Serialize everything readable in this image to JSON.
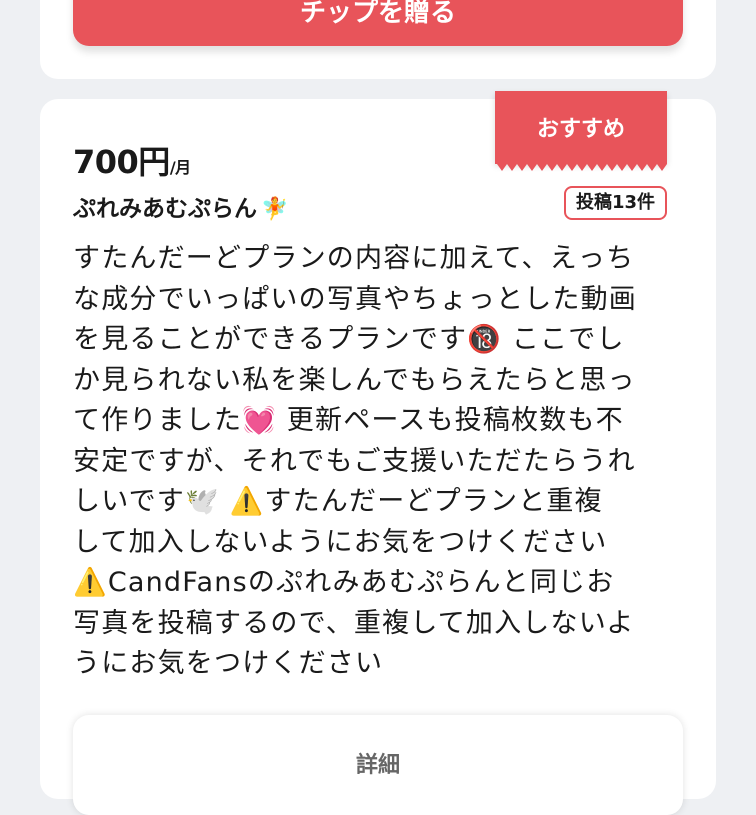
{
  "tip_section": {
    "tip_button_label": "チップを贈る"
  },
  "plan": {
    "recommend_badge": "おすすめ",
    "price_value": "700円",
    "price_unit": "/月",
    "name": "ぷれみあむぷらん",
    "name_icon": "🧚",
    "post_count_label": "投稿13件",
    "description_lines": [
      "すたんだーどプランの内容に加えて、えっち",
      "な成分でいっぱいの写真やちょっとした動画",
      "を見ることができるプランです🔞 ここでし",
      "か見られない私を楽しんでもらえたらと思っ",
      "て作りました💓 更新ペースも投稿枚数も不",
      "安定ですが、それでもご支援いただたらうれ",
      "しいです🕊️ ⚠️すたんだーどプランと重複",
      "して加入しないようにお気をつけください",
      "⚠️CandFansのぷれみあむぷらんと同じお",
      "写真を投稿するので、重複して加入しないよ",
      "うにお気をつけください"
    ],
    "details_button_label": "詳細"
  },
  "colors": {
    "accent": "#e8545a",
    "background": "#eef0f3",
    "card": "#ffffff"
  }
}
